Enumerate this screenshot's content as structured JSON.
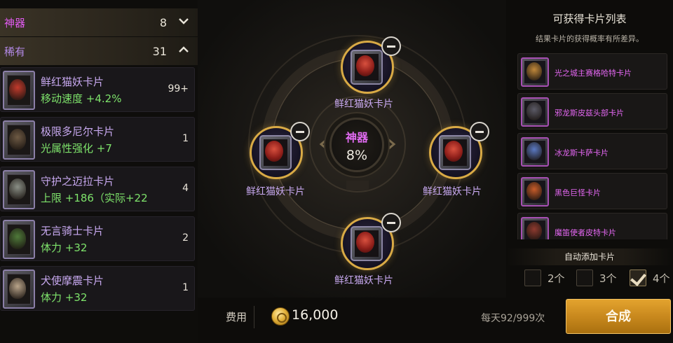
{
  "categories": [
    {
      "name": "神器",
      "count": "8",
      "color": "#e05bf0",
      "expanded": false
    },
    {
      "name": "稀有",
      "count": "31",
      "color": "#b48ae8",
      "expanded": true
    }
  ],
  "cards": [
    {
      "name": "鲜红猫妖卡片",
      "stat": "移动速度 +4.2%",
      "qty": "99+",
      "face_color": "#c23a2c"
    },
    {
      "name": "极限多尼尔卡片",
      "stat": "光属性强化 +7",
      "qty": "1",
      "face_color": "#6e5a44"
    },
    {
      "name": "守护之迈拉卡片",
      "stat": "上限 +186（实际+22",
      "qty": "4",
      "face_color": "#8a8f86"
    },
    {
      "name": "无言骑士卡片",
      "stat": "体力 +32",
      "qty": "2",
      "face_color": "#4f7a3a"
    },
    {
      "name": "犬使摩震卡片",
      "stat": "体力 +32",
      "qty": "1",
      "face_color": "#b9a48a"
    }
  ],
  "center": {
    "core_title": "神器",
    "core_percent": "8%",
    "slots": [
      {
        "label": "鲜红猫妖卡片",
        "position": "top"
      },
      {
        "label": "鲜红猫妖卡片",
        "position": "left"
      },
      {
        "label": "鲜红猫妖卡片",
        "position": "right"
      },
      {
        "label": "鲜红猫妖卡片",
        "position": "bottom"
      }
    ]
  },
  "obtainable": {
    "title": "可获得卡片列表",
    "subtitle": "结果卡片的获得概率有所差异。",
    "items": [
      {
        "name": "光之城主赛格哈特卡片",
        "face_color": "#c0883a"
      },
      {
        "name": "邪龙斯皮兹头部卡片",
        "face_color": "#5b5a66"
      },
      {
        "name": "冰龙斯卡萨卡片",
        "face_color": "#5b79c2"
      },
      {
        "name": "黑色巨怪卡片",
        "face_color": "#c75c2a"
      },
      {
        "name": "魔笛使者皮特卡片",
        "face_color": "#8e3a2f"
      }
    ]
  },
  "auto_add": {
    "label": "自动添加卡片",
    "options": [
      {
        "label": "2个",
        "checked": false
      },
      {
        "label": "3个",
        "checked": false
      },
      {
        "label": "4个",
        "checked": true
      }
    ]
  },
  "footer": {
    "fee_label": "费用",
    "fee_amount": "16,000",
    "daily_limit": "每天92/999次",
    "synth_button": "合成"
  },
  "colors": {
    "artifact_purple": "#e05bf0",
    "rare_purple": "#b48ae8",
    "stat_green": "#7ee36b",
    "gold": "#d9aa45",
    "button_gold": "#c6861c"
  }
}
